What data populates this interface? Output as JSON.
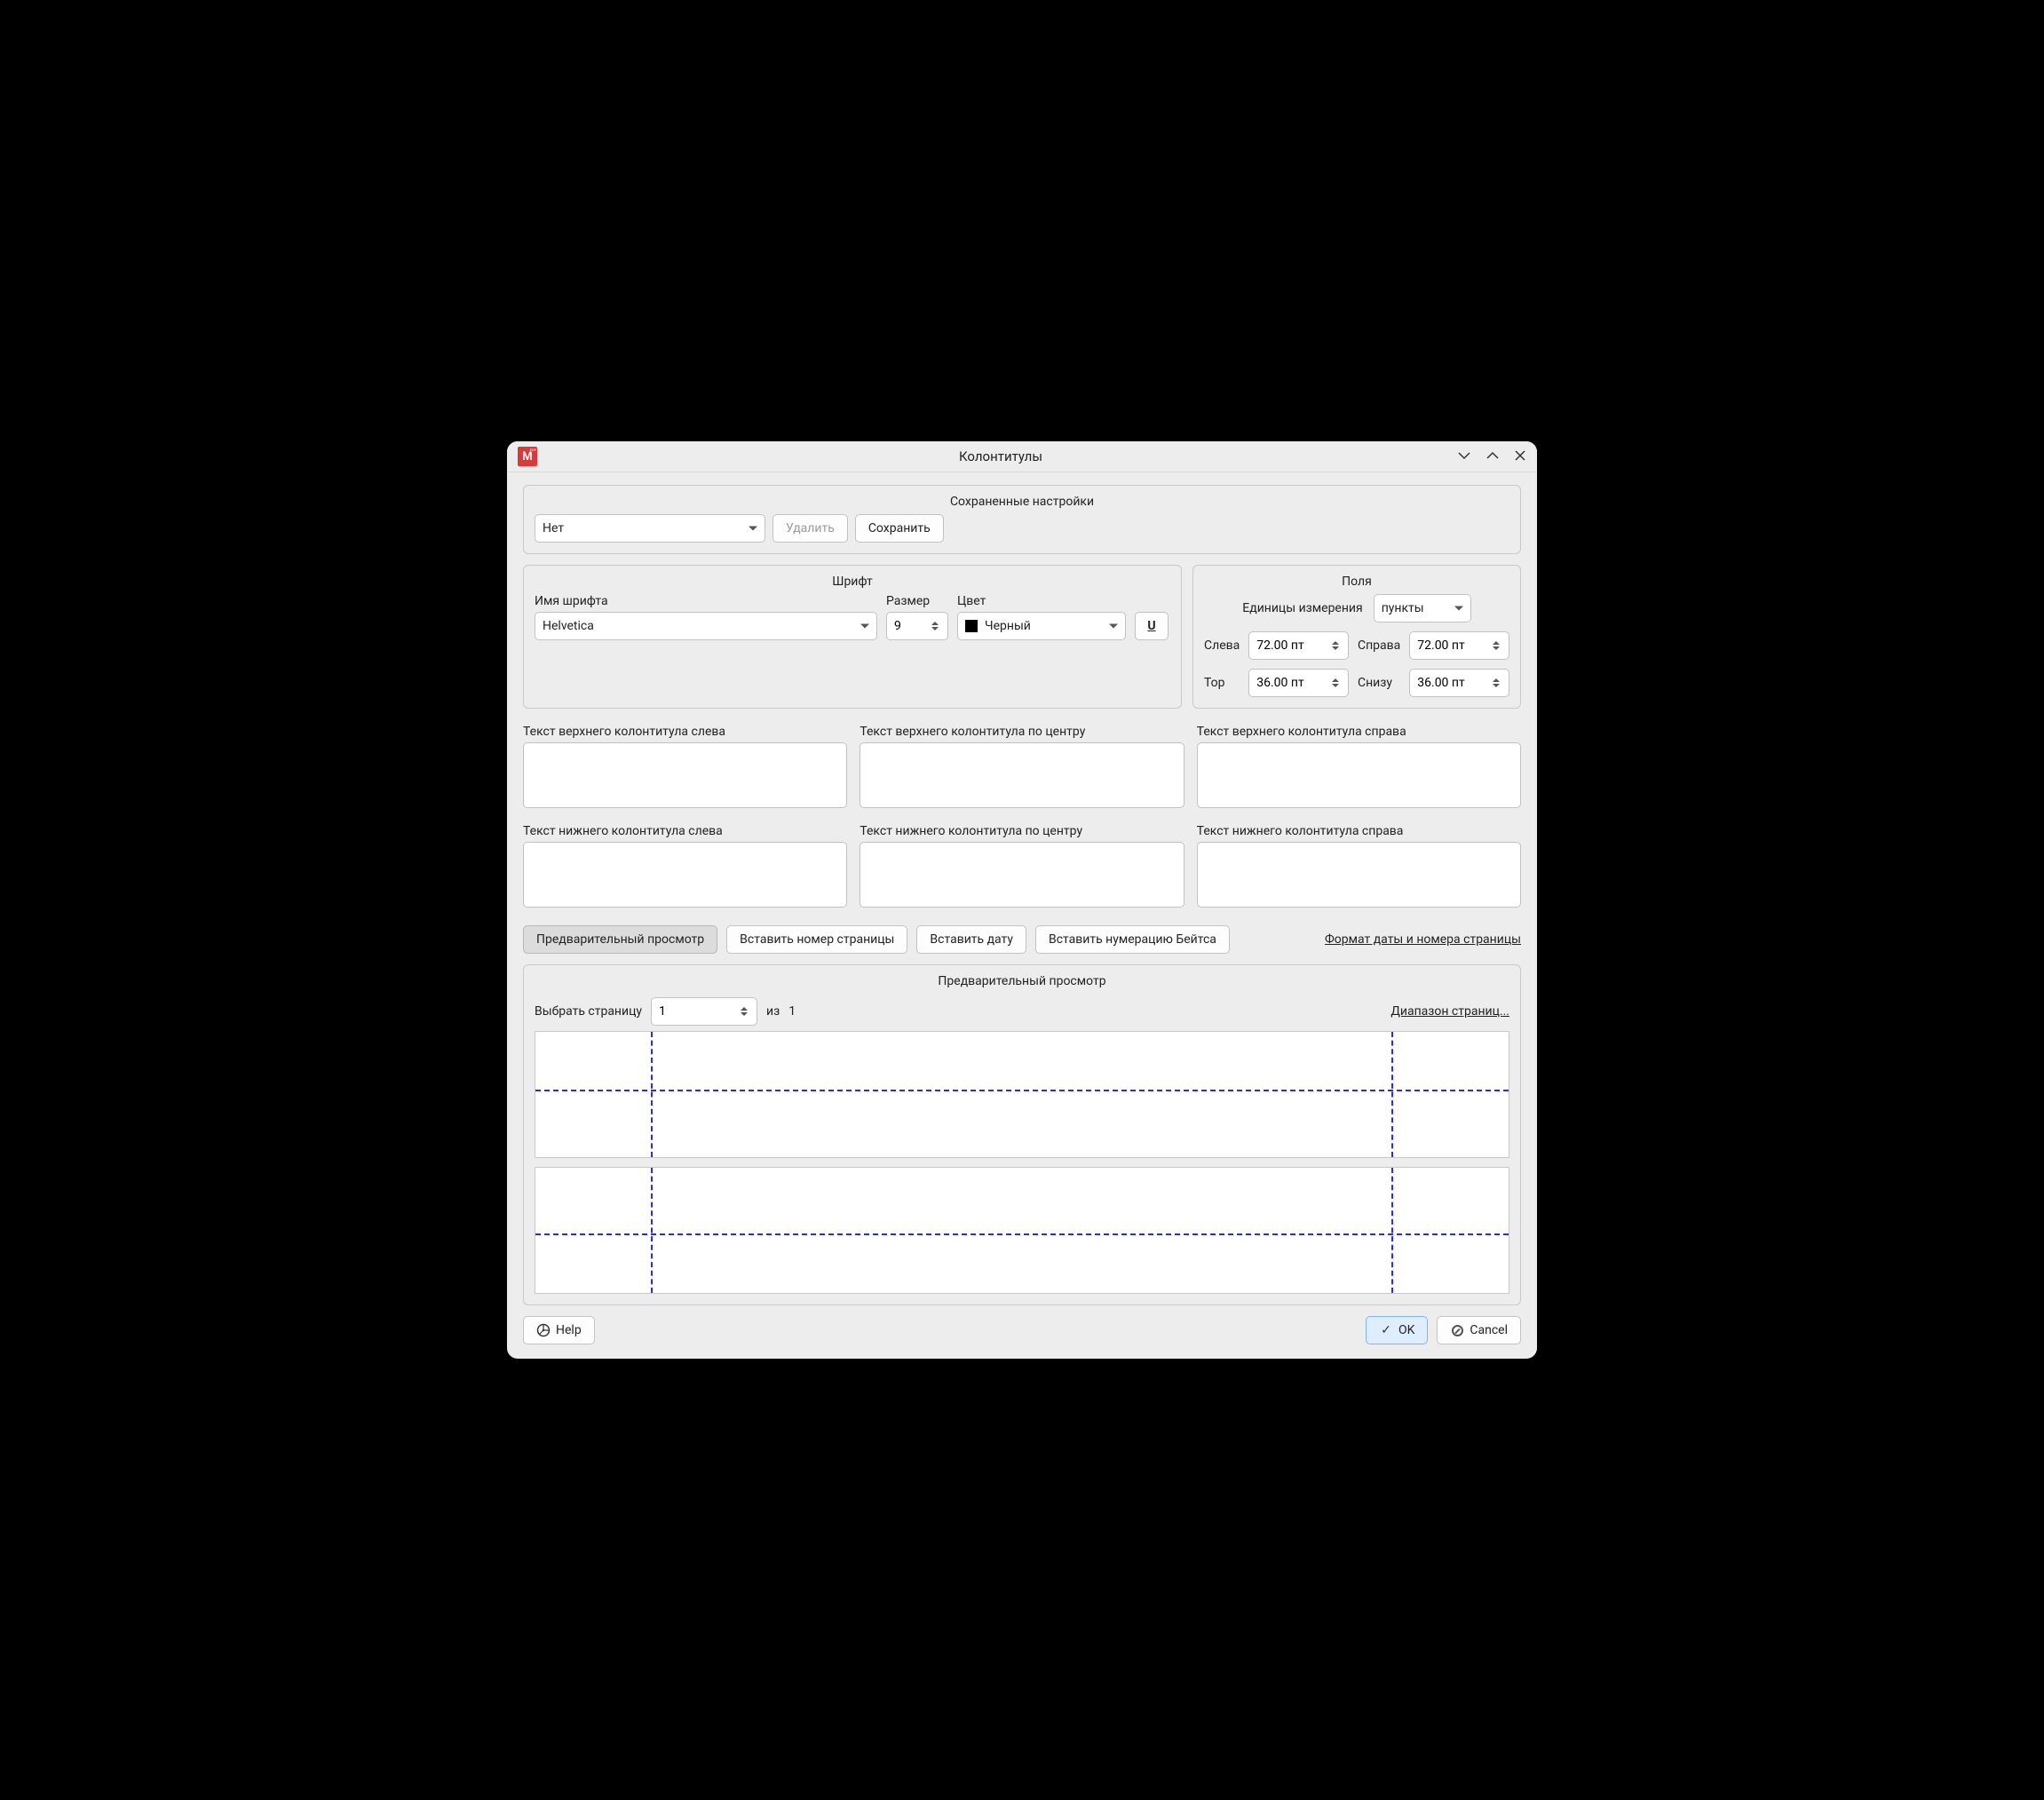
{
  "window": {
    "title": "Колонтитулы"
  },
  "saved": {
    "title": "Сохраненные настройки",
    "preset": "Нет",
    "delete": "Удалить",
    "save": "Сохранить"
  },
  "font": {
    "title": "Шрифт",
    "name_label": "Имя шрифта",
    "name_value": "Helvetica",
    "size_label": "Размер",
    "size_value": "9",
    "color_label": "Цвет",
    "color_value": "Черный",
    "underline": "U"
  },
  "margins": {
    "title": "Поля",
    "units_label": "Единицы измерения",
    "units_value": "пункты",
    "left_label": "Слева",
    "left_value": "72.00 пт",
    "right_label": "Справа",
    "right_value": "72.00 пт",
    "top_label": "Top",
    "top_value": "36.00 пт",
    "bottom_label": "Снизу",
    "bottom_value": "36.00 пт"
  },
  "headers": {
    "htl": "Текст верхнего колонтитула слева",
    "htc": "Текст верхнего колонтитула по центру",
    "htr": "Текст верхнего колонтитула справа",
    "ftl": "Текст нижнего колонтитула слева",
    "ftc": "Текст нижнего колонтитула по центру",
    "ftr": "Текст нижнего колонтитула справа"
  },
  "insert": {
    "preview": "Предварительный просмотр",
    "page_number": "Вставить номер страницы",
    "date": "Вставить дату",
    "bates": "Вставить нумерацию Бейтса",
    "format_link": "Формат даты и номера страницы"
  },
  "preview": {
    "title": "Предварительный просмотр",
    "select_page": "Выбрать страницу",
    "page_value": "1",
    "of_label": "из",
    "total": "1",
    "range_link": "Диапазон страниц..."
  },
  "footer": {
    "help": "Help",
    "ok": "OK",
    "cancel": "Cancel"
  }
}
